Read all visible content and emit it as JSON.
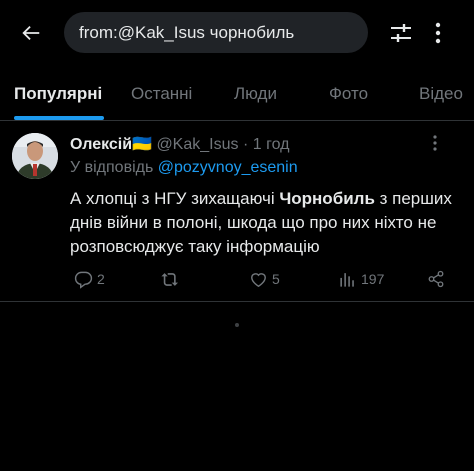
{
  "search": {
    "query": "from:@Kak_Isus чорнобиль"
  },
  "tabs": [
    {
      "label": "Популярні"
    },
    {
      "label": "Останні"
    },
    {
      "label": "Люди"
    },
    {
      "label": "Фото"
    },
    {
      "label": "Відео"
    }
  ],
  "tweet": {
    "author_name": "Олексій🇺🇦",
    "handle": "@Kak_Isus",
    "separator": "·",
    "time": "1 год",
    "reply_prefix": "У відповідь",
    "reply_to": "@pozyvnoy_esenin",
    "text_before": "А хлопці з НГУ зихащаючі ",
    "text_bold": "Чорнобиль",
    "text_after": " з перших днів війни в полоні, шкода що про них ніхто не розповсюджує таку інформацію",
    "replies": "2",
    "retweets": "",
    "likes": "5",
    "views": "197"
  },
  "colors": {
    "background": "#000000",
    "accent": "#1d9bf0",
    "muted": "#71767b",
    "text": "#e7e9ea"
  }
}
